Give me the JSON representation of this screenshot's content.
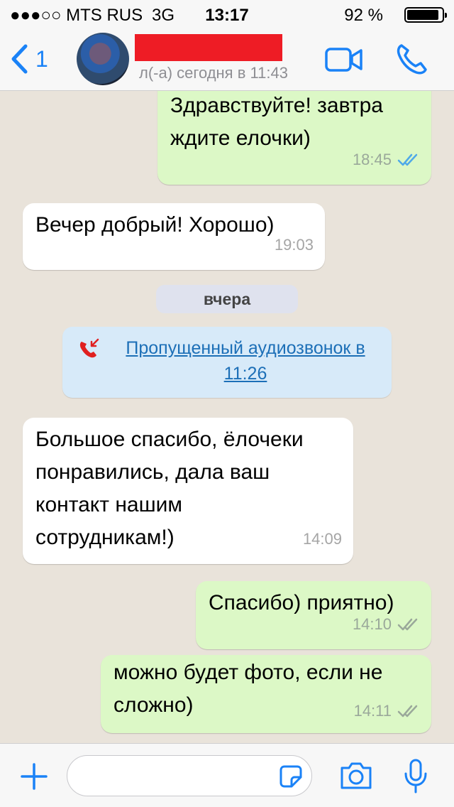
{
  "status_bar": {
    "carrier": "●●●○○ MTS RUS",
    "network": "3G",
    "time": "13:17",
    "battery": "92 %",
    "battery_level": 0.92
  },
  "header": {
    "back_count": "1",
    "last_seen": "л(-а) сегодня в 11:43"
  },
  "messages": [
    {
      "direction": "out",
      "lines": [
        "Здравствуйте! завтра",
        "ждите елочки)"
      ],
      "time": "18:45",
      "ticks": "read"
    },
    {
      "direction": "in",
      "lines": [
        "Вечер добрый! Хорошо)"
      ],
      "time": "19:03"
    },
    {
      "direction": "in",
      "lines": [
        "Большое спасибо, ёлочеки",
        "понравились, дала ваш",
        "контакт нашим",
        "сотрудникам!)"
      ],
      "time": "14:09"
    },
    {
      "direction": "out",
      "lines": [
        "Спасибо) приятно)"
      ],
      "time": "14:10",
      "ticks": "delivered"
    },
    {
      "direction": "out",
      "lines": [
        "можно будет фото, если не",
        "сложно)"
      ],
      "time": "14:11",
      "ticks": "delivered"
    }
  ],
  "date_separator": "вчера",
  "missed_call": {
    "lines": [
      "Пропущенный аудиозвонок в",
      "11:26"
    ]
  },
  "colors": {
    "accent": "#1a82f7",
    "outgoing_bubble": "#dcf8c6",
    "incoming_bubble": "#ffffff",
    "redaction": "#ee1c25",
    "read_ticks": "#4fa9e8",
    "missed_call": "#e02020"
  },
  "icons": {
    "back": "chevron-left-icon",
    "video": "video-call-icon",
    "call": "phone-icon",
    "add": "plus-icon",
    "sticker": "sticker-icon",
    "camera": "camera-icon",
    "mic": "microphone-icon"
  }
}
